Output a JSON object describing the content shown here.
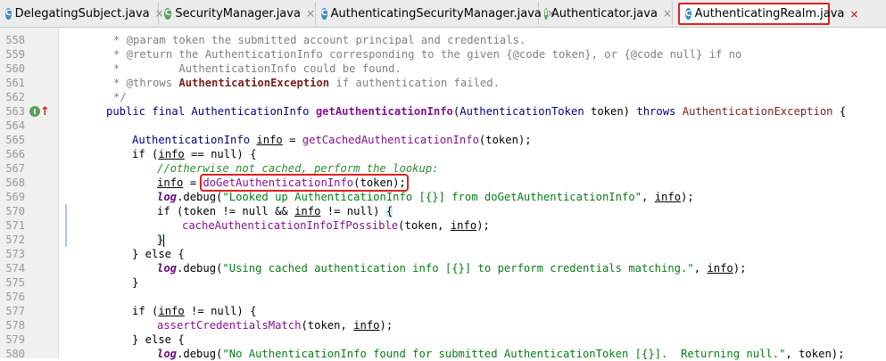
{
  "tabs": [
    {
      "icon": "C",
      "label": "DelegatingSubject.java",
      "kind": "class"
    },
    {
      "icon": "C",
      "label": "SecurityManager.java",
      "kind": "interface"
    },
    {
      "icon": "C",
      "label": "AuthenticatingSecurityManager.java",
      "kind": "class"
    },
    {
      "icon": "I",
      "label": "Authenticator.java",
      "kind": "interface"
    },
    {
      "icon": "C",
      "label": "AuthenticatingRealm.java",
      "kind": "class",
      "active": true
    }
  ],
  "close_glyph": "×",
  "line_numbers": [
    "558",
    "559",
    "560",
    "561",
    "562",
    "563",
    "564",
    "565",
    "566",
    "567",
    "568",
    "569",
    "570",
    "571",
    "572",
    "573",
    "574",
    "575",
    "576",
    "577",
    "578",
    "579",
    "580"
  ],
  "gutter_marker": {
    "line": "563",
    "label": "I↑"
  },
  "code": {
    "l558a": "* @param token the submitted account principal and credentials.",
    "l559a": "* @return the AuthenticationInfo corresponding to the given {@code token}, or {@code null} if no",
    "l560a": "*         AuthenticationInfo could be found.",
    "l561a": "* @throws ",
    "l561b": "AuthenticationException",
    "l561c": " if authentication failed.",
    "l562a": "*/",
    "l563a": "public final ",
    "l563b": "AuthenticationInfo ",
    "l563c": "getAuthenticationInfo",
    "l563d": "(",
    "l563e": "AuthenticationToken ",
    "l563f": "token) ",
    "l563g": "throws ",
    "l563h": "AuthenticationException",
    "l563i": " {",
    "l565a": "AuthenticationInfo ",
    "l565b": "info",
    "l565c": " = ",
    "l565d": "getCachedAuthenticationInfo",
    "l565e": "(token);",
    "l566a": "if (",
    "l566b": "info",
    "l566c": " == null) {",
    "l567a": "//otherwise not cached, perform the lookup:",
    "l568a": "info",
    "l568b": " = ",
    "l568c": "doGetAuthenticationInfo",
    "l568d": "(token);",
    "l569a": "log",
    "l569b": ".debug(",
    "l569c": "\"Looked up AuthenticationInfo [{}] from doGetAuthenticationInfo\"",
    "l569d": ", ",
    "l569e": "info",
    "l569f": ");",
    "l570a": "if (token != null && ",
    "l570b": "info",
    "l570c": " != null) ",
    "l570d": "{",
    "l571a": "cacheAuthenticationInfoIfPossible",
    "l571b": "(token, ",
    "l571c": "info",
    "l571d": ");",
    "l572a": "}",
    "l573a": "} else {",
    "l574a": "log",
    "l574b": ".debug(",
    "l574c": "\"Using cached authentication info [{}] to perform credentials matching.\"",
    "l574d": ", ",
    "l574e": "info",
    "l574f": ");",
    "l575a": "}",
    "l577a": "if (",
    "l577b": "info",
    "l577c": " != null) {",
    "l578a": "assertCredentialsMatch",
    "l578b": "(token, ",
    "l578c": "info",
    "l578d": ");",
    "l579a": "} else {",
    "l580a": "log",
    "l580b": ".debug(",
    "l580c": "\"No AuthenticationInfo found for submitted AuthenticationToken [{}].  Returning null.\"",
    "l580d": ", token);"
  }
}
